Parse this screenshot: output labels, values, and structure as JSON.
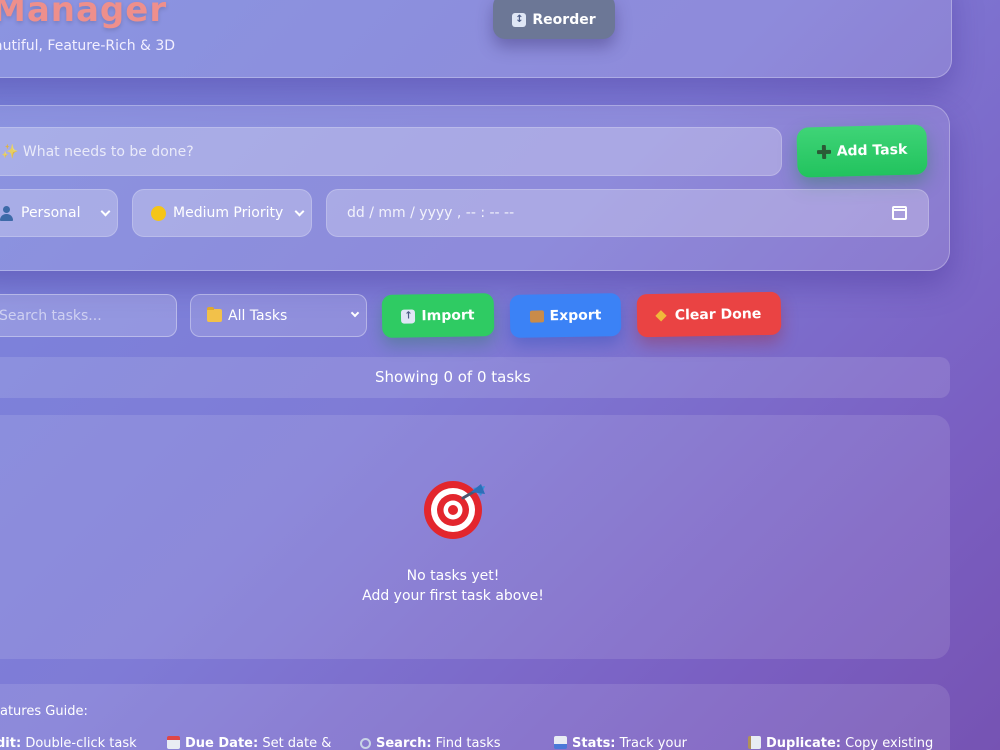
{
  "header": {
    "title": "Manager",
    "subtitle": "autiful, Feature-Rich & 3D",
    "reorder_label": "Reorder"
  },
  "task_form": {
    "task_placeholder": "✨ What needs to be done?",
    "add_label": "Add Task",
    "category_value": "Personal",
    "priority_value": "Medium Priority",
    "date_placeholder": "dd / mm / yyyy ,  -- : --  --"
  },
  "toolbar": {
    "search_placeholder": "Search tasks...",
    "filter_value": "All Tasks",
    "import_label": "Import",
    "export_label": "Export",
    "clear_label": "Clear Done"
  },
  "status": {
    "text": "Showing 0 of 0 tasks"
  },
  "empty_state": {
    "icon": "target-icon",
    "line1": "No tasks yet!",
    "line2": "Add your first task above!"
  },
  "guide": {
    "title": "eatures Guide:",
    "items": [
      {
        "label": "dit:",
        "text": " Double-click task"
      },
      {
        "label": "Due Date:",
        "text": " Set date &"
      },
      {
        "label": "Search:",
        "text": " Find tasks"
      },
      {
        "label": "Stats:",
        "text": " Track your"
      },
      {
        "label": "Duplicate:",
        "text": " Copy existing"
      }
    ]
  },
  "colors": {
    "title": "#ee8f8c",
    "add_button": "#22c35e",
    "import_button": "#2fcb63",
    "export_button": "#3b82f6",
    "clear_button": "#ea4343",
    "reorder_button": "#6c7796",
    "priority_dot": "#f5c518"
  }
}
